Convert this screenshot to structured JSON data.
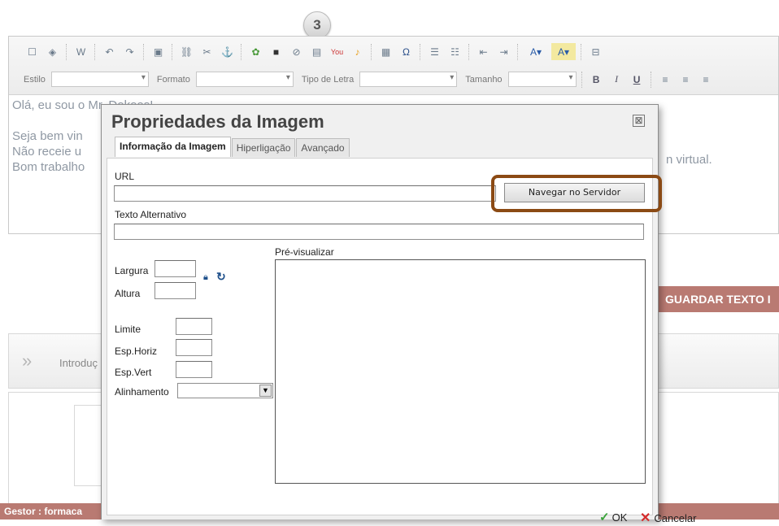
{
  "step_badge": "3",
  "editor": {
    "toolbar": {
      "style_label": "Estilo",
      "format_label": "Formato",
      "font_label": "Tipo de Letra",
      "size_label": "Tamanho",
      "bold": "B",
      "italic": "I",
      "underline": "U",
      "youtube": "You"
    },
    "content": {
      "line1": "Olá, eu sou o Mr. Dokoos!",
      "line2": "Seja bem vin",
      "line3": "Não receie u",
      "line3_tail": "n virtual.",
      "line4": "Bom trabalho"
    }
  },
  "page": {
    "guardar_button": "GUARDAR TEXTO I",
    "intro_text": "Introduç",
    "footer_text": "Gestor : formaca"
  },
  "dialog": {
    "title": "Propriedades da Imagem",
    "close": "⊠",
    "tabs": [
      {
        "label": "Informação da Imagem",
        "active": true
      },
      {
        "label": "Hiperligação",
        "active": false
      },
      {
        "label": "Avançado",
        "active": false
      }
    ],
    "url_label": "URL",
    "browse_button": "Navegar no Servidor",
    "alt_label": "Texto Alternativo",
    "preview_label": "Pré-visualizar",
    "width_label": "Largura",
    "height_label": "Altura",
    "border_label": "Limite",
    "hspace_label": "Esp.Horiz",
    "vspace_label": "Esp.Vert",
    "align_label": "Alinhamento",
    "ok_button": "OK",
    "cancel_button": "Cancelar"
  },
  "colors": {
    "highlight": "#8b4a14",
    "accent_bar": "#b97a72"
  }
}
